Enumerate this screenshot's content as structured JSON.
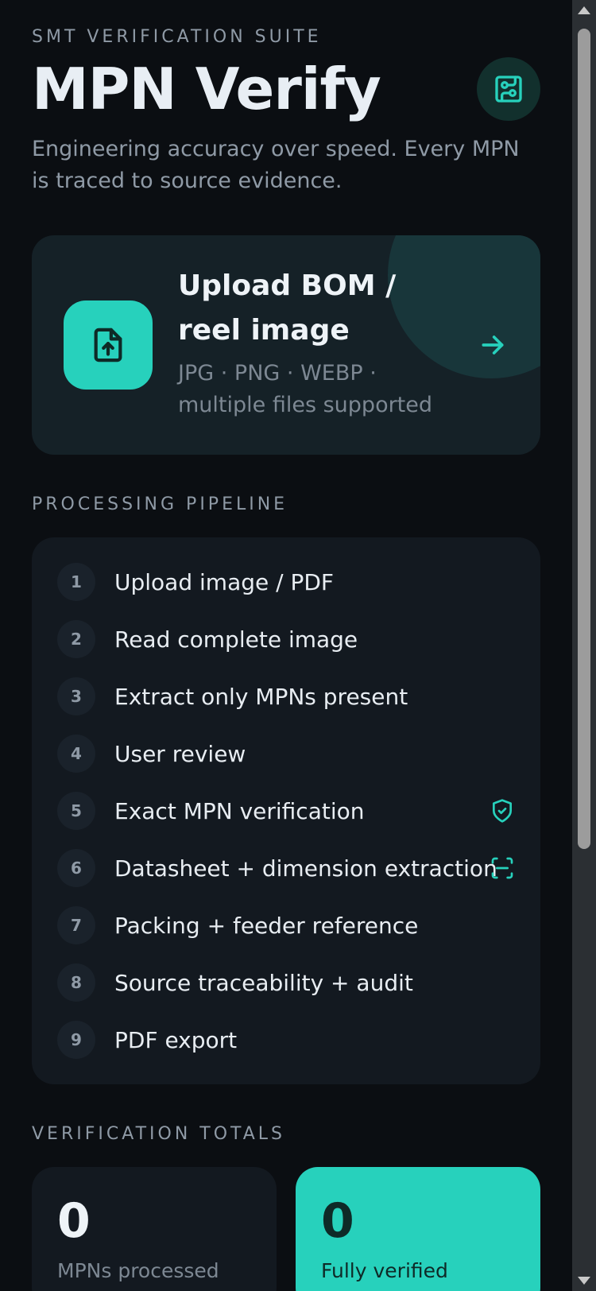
{
  "header": {
    "eyebrow": "SMT VERIFICATION SUITE",
    "title": "MPN Verify",
    "subtitle": "Engineering accuracy over speed. Every MPN is traced to source evidence.",
    "logo_icon": "circuit-board-icon"
  },
  "upload": {
    "title": "Upload BOM / reel image",
    "subtitle": "JPG · PNG · WEBP · multiple files supported",
    "icon": "file-upload-icon",
    "arrow_icon": "arrow-right-icon"
  },
  "pipeline": {
    "label": "PROCESSING PIPELINE",
    "steps": [
      {
        "num": "1",
        "label": "Upload image / PDF"
      },
      {
        "num": "2",
        "label": "Read complete image"
      },
      {
        "num": "3",
        "label": "Extract only MPNs present"
      },
      {
        "num": "4",
        "label": "User review"
      },
      {
        "num": "5",
        "label": "Exact MPN verification",
        "icon": "shield-check-icon"
      },
      {
        "num": "6",
        "label": "Datasheet + dimension extraction",
        "icon": "scan-icon"
      },
      {
        "num": "7",
        "label": "Packing + feeder reference"
      },
      {
        "num": "8",
        "label": "Source traceability + audit"
      },
      {
        "num": "9",
        "label": "PDF export"
      }
    ]
  },
  "totals": {
    "label": "VERIFICATION TOTALS",
    "processed": {
      "value": "0",
      "label": "MPNs processed"
    },
    "verified": {
      "value": "0",
      "label": "Fully verified"
    }
  },
  "colors": {
    "background": "#0b0e12",
    "accent": "#27d1bc",
    "card": "#131920",
    "muted_text": "#8f9aa6"
  }
}
